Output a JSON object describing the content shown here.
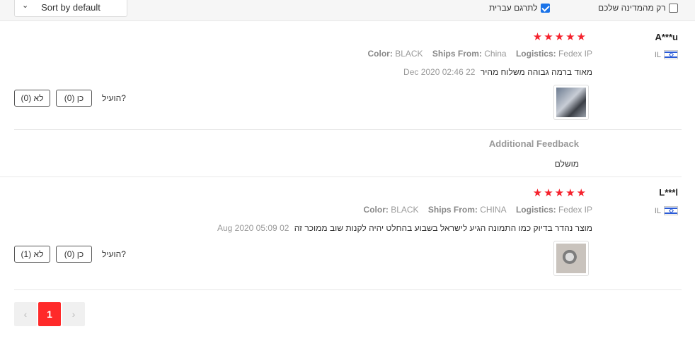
{
  "toolbar": {
    "sort_label": "Sort by default",
    "translate_label": "לתרגם עברית",
    "translate_checked": true,
    "my_country_label": "רק מהמדינה שלכם",
    "my_country_checked": false
  },
  "reviews": [
    {
      "user": "A***u",
      "country": "IL",
      "rating": 5,
      "color_label": "Color:",
      "color": "BLACK",
      "ships_label": "Ships From:",
      "ships_from": "China",
      "logistics_label": "Logistics:",
      "logistics": "Fedex IP",
      "text": "מאוד ברמה גבוהה משלוח מהיר",
      "date": "22 Dec 2020 02:46",
      "helpful_label": "הועיל?",
      "yes_label": "כן (0)",
      "no_label": "לא (0)",
      "additional_title": "Additional Feedback",
      "additional_text": "מושלם"
    },
    {
      "user": "L***l",
      "country": "IL",
      "rating": 5,
      "color_label": "Color:",
      "color": "BLACK",
      "ships_label": "Ships From:",
      "ships_from": "CHINA",
      "logistics_label": "Logistics:",
      "logistics": "Fedex IP",
      "text": "מוצר נהדר בדיוק כמו התמונה הגיע לישראל בשבוע בהחלט יהיה לקנות שוב ממוכר זה",
      "date": "02 Aug 2020 05:09",
      "helpful_label": "הועיל?",
      "yes_label": "כן (0)",
      "no_label": "לא (1)"
    }
  ],
  "pagination": {
    "prev": "‹",
    "current": "1",
    "next": "›"
  },
  "icons": {
    "star": "★",
    "chevron_down": "⌄"
  }
}
